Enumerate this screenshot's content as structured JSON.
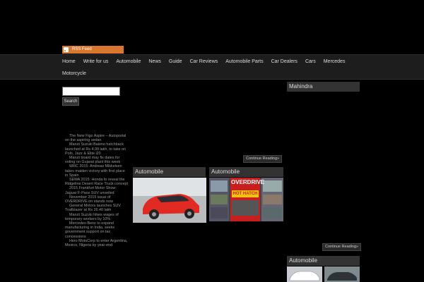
{
  "rss": {
    "label": "RSS Feed"
  },
  "nav": {
    "row1": [
      "Home",
      "Write for us",
      "Automobile",
      "News",
      "Guide",
      "Car Reviews",
      "Automobile Parts",
      "Car Dealers",
      "Cars",
      "Mercedes"
    ],
    "row2": [
      "Motorcycle"
    ]
  },
  "search": {
    "button_label": "Search",
    "placeholder": ""
  },
  "news_items": [
    "The New Figo Aspire – Autoportal on the aspiring sedan",
    "Maruti Suzuki Baleno hatchback launched at Rs 4.99 lakh, to take on Polo, Jazz & Elite i20",
    "Maruti board may fix dates for voting on Gujarat plant this week",
    "WRC 2015: Andreas Mikkelsen takes maiden victory with first place in Spain",
    "SEMA 2015: Honda to reveal the Ridgeline Desert Race Truck concept",
    "2015 Frankfurt Motor Show: Jaguar F-Pace SUV unveiled",
    "November 2015 issue of OVERDRIVE on stands now",
    "General Motors launches SUV Trailblazer at Rs 26.40 lakh",
    "Maruti Suzuki hikes wages of temporary workers by 10%",
    "Mercedes-Benz to expand manufacturing in India, seeks government support on tax concessions",
    "Hero MotoCorp to enter Argentina, Mexico, Nigeria by year-end"
  ],
  "continue_label": "Continue Reading»",
  "boxes": {
    "automobile_1": "Automobile",
    "automobile_2": "Automobile",
    "mahindra": "Mahindra",
    "automobile_3": "Automobile"
  },
  "magazine": {
    "title": "OVERDRIVE",
    "headline": "HOT HATCH"
  },
  "colors": {
    "rss_bg": "#d9772e",
    "nav_bg": "#1d1d1d",
    "title_bg": "#333333"
  }
}
